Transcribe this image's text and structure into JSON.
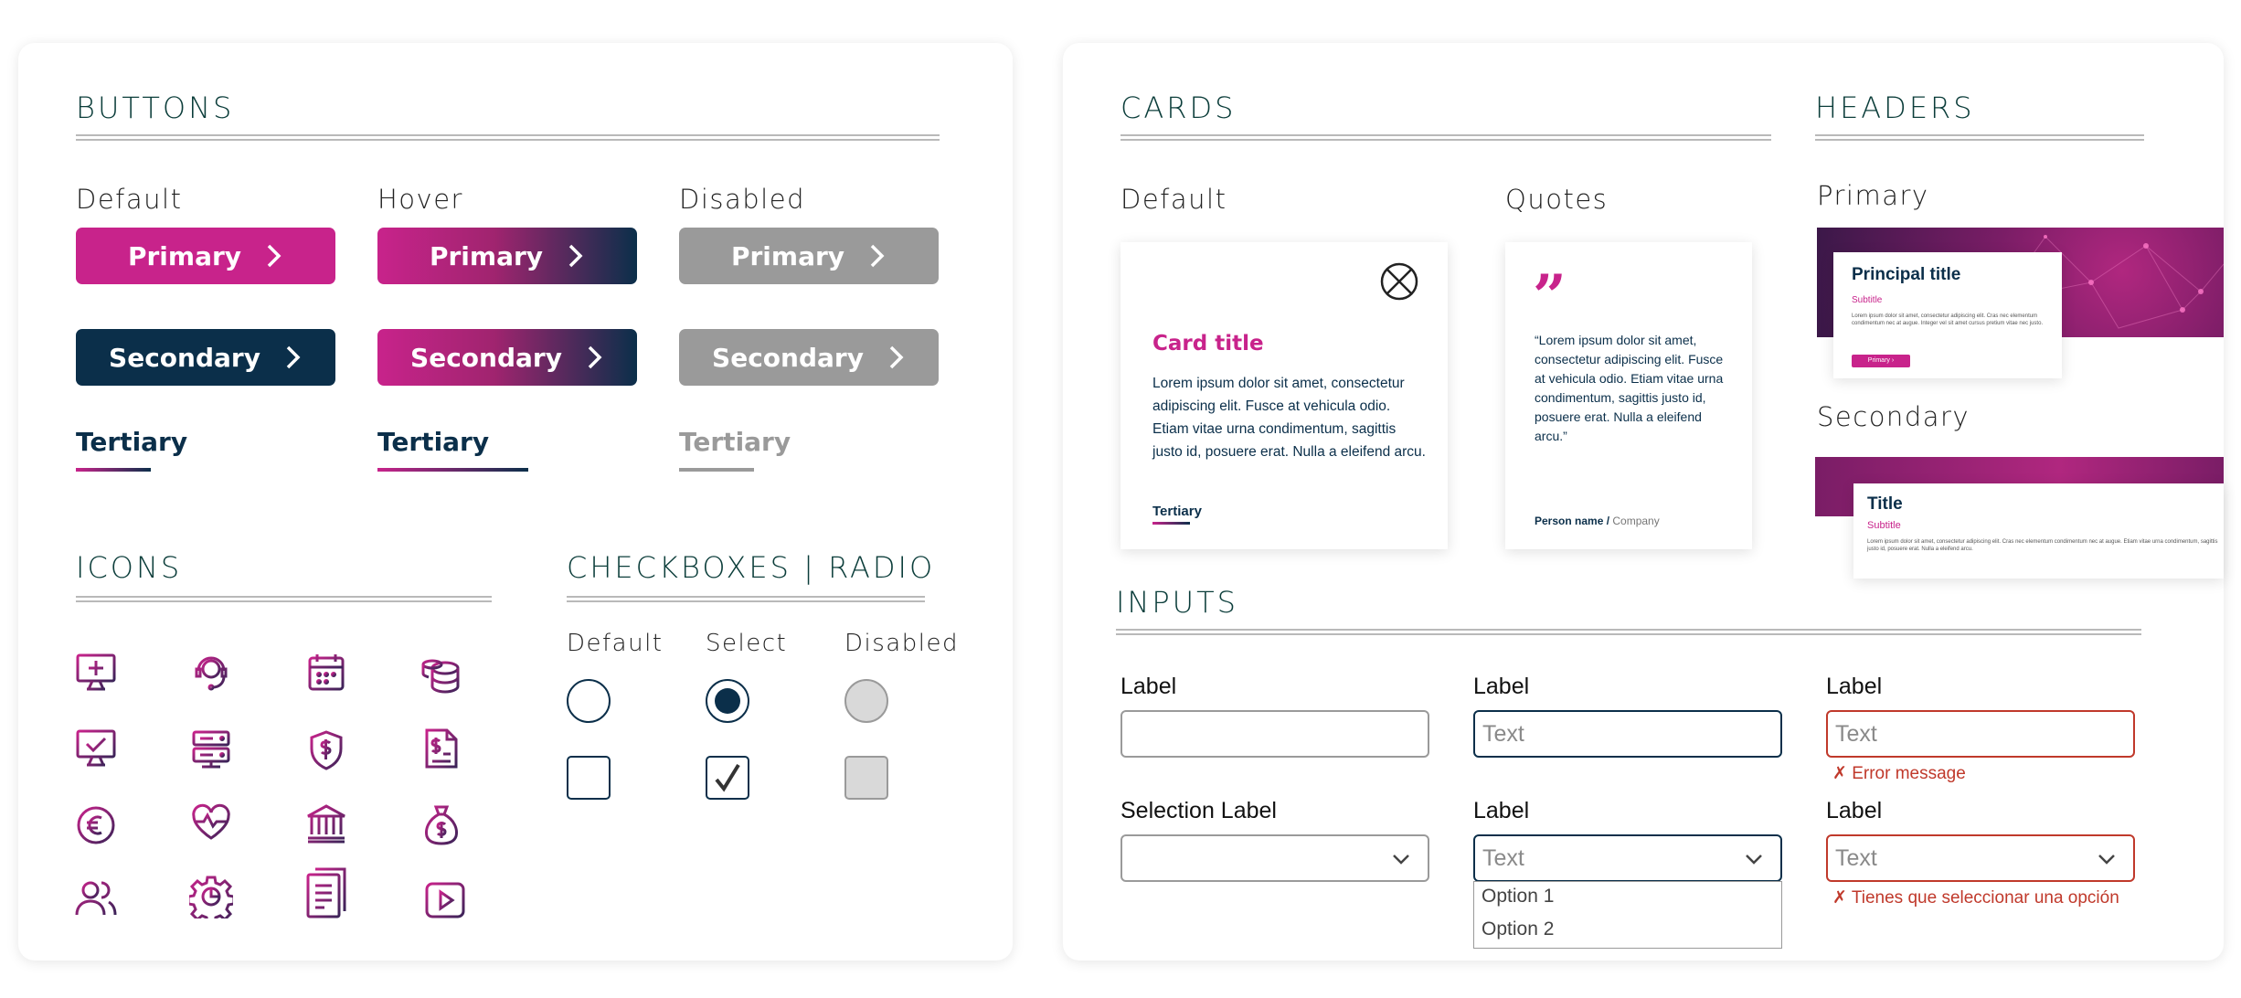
{
  "buttons": {
    "title": "BUTTONS",
    "states": [
      "Default",
      "Hover",
      "Disabled"
    ],
    "primary_label": "Primary",
    "secondary_label": "Secondary",
    "tertiary_label": "Tertiary"
  },
  "icons": {
    "title": "ICONS",
    "names": [
      "monitor-plus-icon",
      "headset-agent-icon",
      "calendar-icon",
      "coins-stack-icon",
      "monitor-check-icon",
      "server-icon",
      "shield-dollar-icon",
      "invoice-dollar-icon",
      "euro-coin-icon",
      "heart-pulse-icon",
      "bank-icon",
      "money-bag-icon",
      "users-icon",
      "gear-chart-icon",
      "documents-icon",
      "play-video-icon"
    ]
  },
  "checks": {
    "title": "CHECKBOXES | RADIO",
    "states": [
      "Default",
      "Select",
      "Disabled"
    ]
  },
  "cards": {
    "title": "CARDS",
    "states": [
      "Default",
      "Quotes"
    ],
    "card_title": "Card title",
    "card_body": "Lorem ipsum dolor sit amet, consectetur adipiscing elit. Fusce at vehicula odio. Etiam vitae urna condimentum, sagittis justo id, posuere erat. Nulla a eleifend arcu.",
    "card_link": "Tertiary",
    "quote_mark": "”",
    "quote_body": "“Lorem ipsum dolor sit amet, consectetur adipiscing elit. Fusce at vehicula odio. Etiam vitae urna condimentum, sagittis justo id, posuere erat. Nulla a eleifend arcu.”",
    "quote_person": "Person name /",
    "quote_company": "Company"
  },
  "headers": {
    "title": "HEADERS",
    "primary_label": "Primary",
    "secondary_label": "Secondary",
    "primary_title": "Principal title",
    "primary_subtitle": "Subtitle",
    "primary_body": "Lorem ipsum dolor sit amet, consectetur adipiscing elit. Cras nec elementum condimentum nec at augue. Integer vel sit amet cursus pretium vitae nec justo.",
    "primary_button": "Primary",
    "secondary_title": "Title",
    "secondary_subtitle": "Subtitle",
    "secondary_body": "Lorem ipsum dolor sit amet, consectetur adipiscing elit. Cras nec elementum condimentum nec at augue. Etiam vitae urna condimentum, sagittis justo id, posuere erat. Nulla a eleifend arcu."
  },
  "inputs": {
    "title": "INPUTS",
    "label": "Label",
    "selection_label": "Selection Label",
    "text_value": "Text",
    "error_message": "Error message",
    "select_error": "Tienes que seleccionar una opción",
    "options": [
      "Option 1",
      "Option 2"
    ]
  },
  "colors": {
    "magenta": "#c8238b",
    "navy": "#0b2f4a",
    "disabled": "#9a9a9a",
    "error": "#c0392b"
  }
}
